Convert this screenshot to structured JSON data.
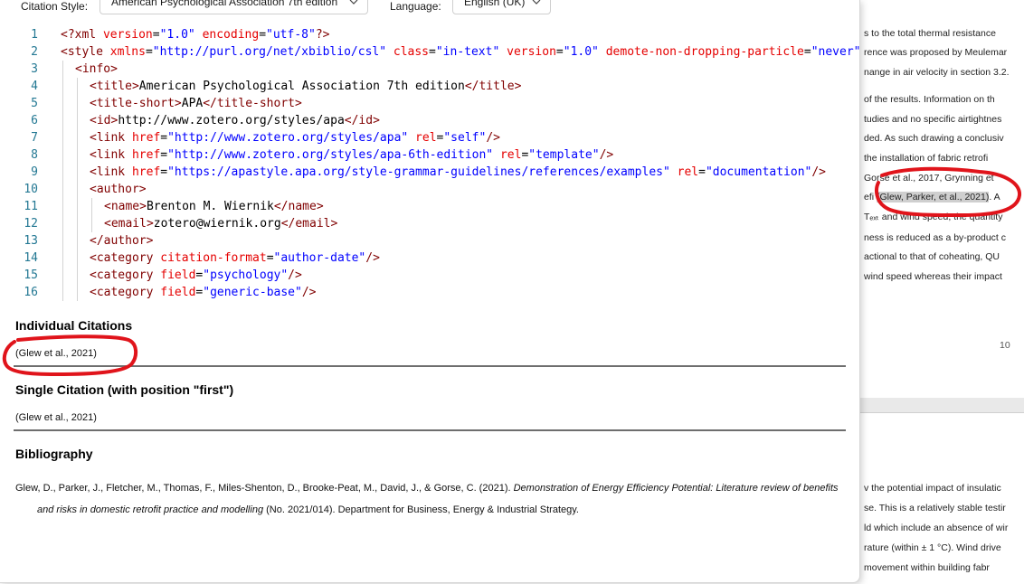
{
  "toolbar": {
    "citation_style_label": "Citation Style:",
    "citation_style_value": "American Psychological Association 7th edition",
    "language_label": "Language:",
    "language_value": "English (UK)"
  },
  "editor": {
    "line_numbers": [
      "1",
      "2",
      "3",
      "4",
      "5",
      "6",
      "7",
      "8",
      "9",
      "10",
      "11",
      "12",
      "13",
      "14",
      "15",
      "16"
    ],
    "lines": [
      [
        [
          "pi",
          "<?xml "
        ],
        [
          "attr",
          "version"
        ],
        [
          "text",
          "="
        ],
        [
          "val",
          "\"1.0\""
        ],
        [
          "text",
          " "
        ],
        [
          "attr",
          "encoding"
        ],
        [
          "text",
          "="
        ],
        [
          "val",
          "\"utf-8\""
        ],
        [
          "pi",
          "?>"
        ]
      ],
      [
        [
          "tag",
          "<style "
        ],
        [
          "attr",
          "xmlns"
        ],
        [
          "text",
          "="
        ],
        [
          "val",
          "\"http://purl.org/net/xbiblio/csl\""
        ],
        [
          "text",
          " "
        ],
        [
          "attr",
          "class"
        ],
        [
          "text",
          "="
        ],
        [
          "val",
          "\"in-text\""
        ],
        [
          "text",
          " "
        ],
        [
          "attr",
          "version"
        ],
        [
          "text",
          "="
        ],
        [
          "val",
          "\"1.0\""
        ],
        [
          "text",
          " "
        ],
        [
          "attr",
          "demote-non-dropping-particle"
        ],
        [
          "text",
          "="
        ],
        [
          "val",
          "\"never\""
        ]
      ],
      [
        [
          "tag",
          "<info>"
        ]
      ],
      [
        [
          "tag",
          "<title>"
        ],
        [
          "text",
          "American Psychological Association 7th edition"
        ],
        [
          "tag",
          "</title>"
        ]
      ],
      [
        [
          "tag",
          "<title-short>"
        ],
        [
          "text",
          "APA"
        ],
        [
          "tag",
          "</title-short>"
        ]
      ],
      [
        [
          "tag",
          "<id>"
        ],
        [
          "text",
          "http://www.zotero.org/styles/apa"
        ],
        [
          "tag",
          "</id>"
        ]
      ],
      [
        [
          "tag",
          "<link "
        ],
        [
          "attr",
          "href"
        ],
        [
          "text",
          "="
        ],
        [
          "val",
          "\"http://www.zotero.org/styles/apa\""
        ],
        [
          "text",
          " "
        ],
        [
          "attr",
          "rel"
        ],
        [
          "text",
          "="
        ],
        [
          "val",
          "\"self\""
        ],
        [
          "tag",
          "/>"
        ]
      ],
      [
        [
          "tag",
          "<link "
        ],
        [
          "attr",
          "href"
        ],
        [
          "text",
          "="
        ],
        [
          "val",
          "\"http://www.zotero.org/styles/apa-6th-edition\""
        ],
        [
          "text",
          " "
        ],
        [
          "attr",
          "rel"
        ],
        [
          "text",
          "="
        ],
        [
          "val",
          "\"template\""
        ],
        [
          "tag",
          "/>"
        ]
      ],
      [
        [
          "tag",
          "<link "
        ],
        [
          "attr",
          "href"
        ],
        [
          "text",
          "="
        ],
        [
          "val",
          "\"https://apastyle.apa.org/style-grammar-guidelines/references/examples\""
        ],
        [
          "text",
          " "
        ],
        [
          "attr",
          "rel"
        ],
        [
          "text",
          "="
        ],
        [
          "val",
          "\"documentation\""
        ],
        [
          "tag",
          "/>"
        ]
      ],
      [
        [
          "tag",
          "<author>"
        ]
      ],
      [
        [
          "tag",
          "<name>"
        ],
        [
          "text",
          "Brenton M. Wiernik"
        ],
        [
          "tag",
          "</name>"
        ]
      ],
      [
        [
          "tag",
          "<email>"
        ],
        [
          "text",
          "zotero@wiernik.org"
        ],
        [
          "tag",
          "</email>"
        ]
      ],
      [
        [
          "tag",
          "</author>"
        ]
      ],
      [
        [
          "tag",
          "<category "
        ],
        [
          "attr",
          "citation-format"
        ],
        [
          "text",
          "="
        ],
        [
          "val",
          "\"author-date\""
        ],
        [
          "tag",
          "/>"
        ]
      ],
      [
        [
          "tag",
          "<category "
        ],
        [
          "attr",
          "field"
        ],
        [
          "text",
          "="
        ],
        [
          "val",
          "\"psychology\""
        ],
        [
          "tag",
          "/>"
        ]
      ],
      [
        [
          "tag",
          "<category "
        ],
        [
          "attr",
          "field"
        ],
        [
          "text",
          "="
        ],
        [
          "val",
          "\"generic-base\""
        ],
        [
          "tag",
          "/>"
        ]
      ]
    ],
    "indents": [
      0,
      0,
      1,
      2,
      2,
      2,
      2,
      2,
      2,
      2,
      3,
      3,
      2,
      2,
      2,
      2
    ]
  },
  "preview": {
    "individual_heading": "Individual Citations",
    "individual_text": "(Glew et al., 2021)",
    "single_heading": "Single Citation (with position \"first\")",
    "single_text": "(Glew et al., 2021)",
    "bibliography_heading": "Bibliography",
    "bib_authors": "Glew, D., Parker, J., Fletcher, M., Thomas, F., Miles-Shenton, D., Brooke-Peat, M., David, J., & Gorse, C. (2021). ",
    "bib_title": "Demonstration of Energy Efficiency Potential: Literature review of benefits and risks in domestic retrofit practice and modelling",
    "bib_rest": " (No. 2021/014). Department for Business, Energy & Industrial Strategy."
  },
  "document": {
    "page1_lines": [
      "s to the total thermal resistance",
      "rence was proposed by Meulemar",
      "nange in air velocity in section 3.2.",
      "",
      "of the results. Information on th",
      "tudies and no specific airtightnes",
      "ded. As such drawing a conclusiv",
      "the installation of fabric retrofi",
      "Gorse et al., 2017, Grynning et",
      "efi (Glew, Parker, et al., 2021). A",
      "Tₑₓₜ and wind speed, the quantity",
      "ness is reduced as a by-product c",
      "actional to that of coheating, QU",
      "wind speed whereas their impact"
    ],
    "highlighted_citation": "(Glew, Parker, et al., 2021)",
    "page_number": "10",
    "page2_lines": [
      "v the potential impact of insulatic",
      "se. This is a relatively stable testir",
      "ld which include an absence of wir",
      "rature (within ± 1 °C). Wind drive",
      "movement within building fabr"
    ]
  },
  "colors": {
    "annotation": "#e0141b",
    "tag": "#800000",
    "attribute": "#e50000",
    "value": "#0000ff",
    "line_number": "#237893"
  }
}
